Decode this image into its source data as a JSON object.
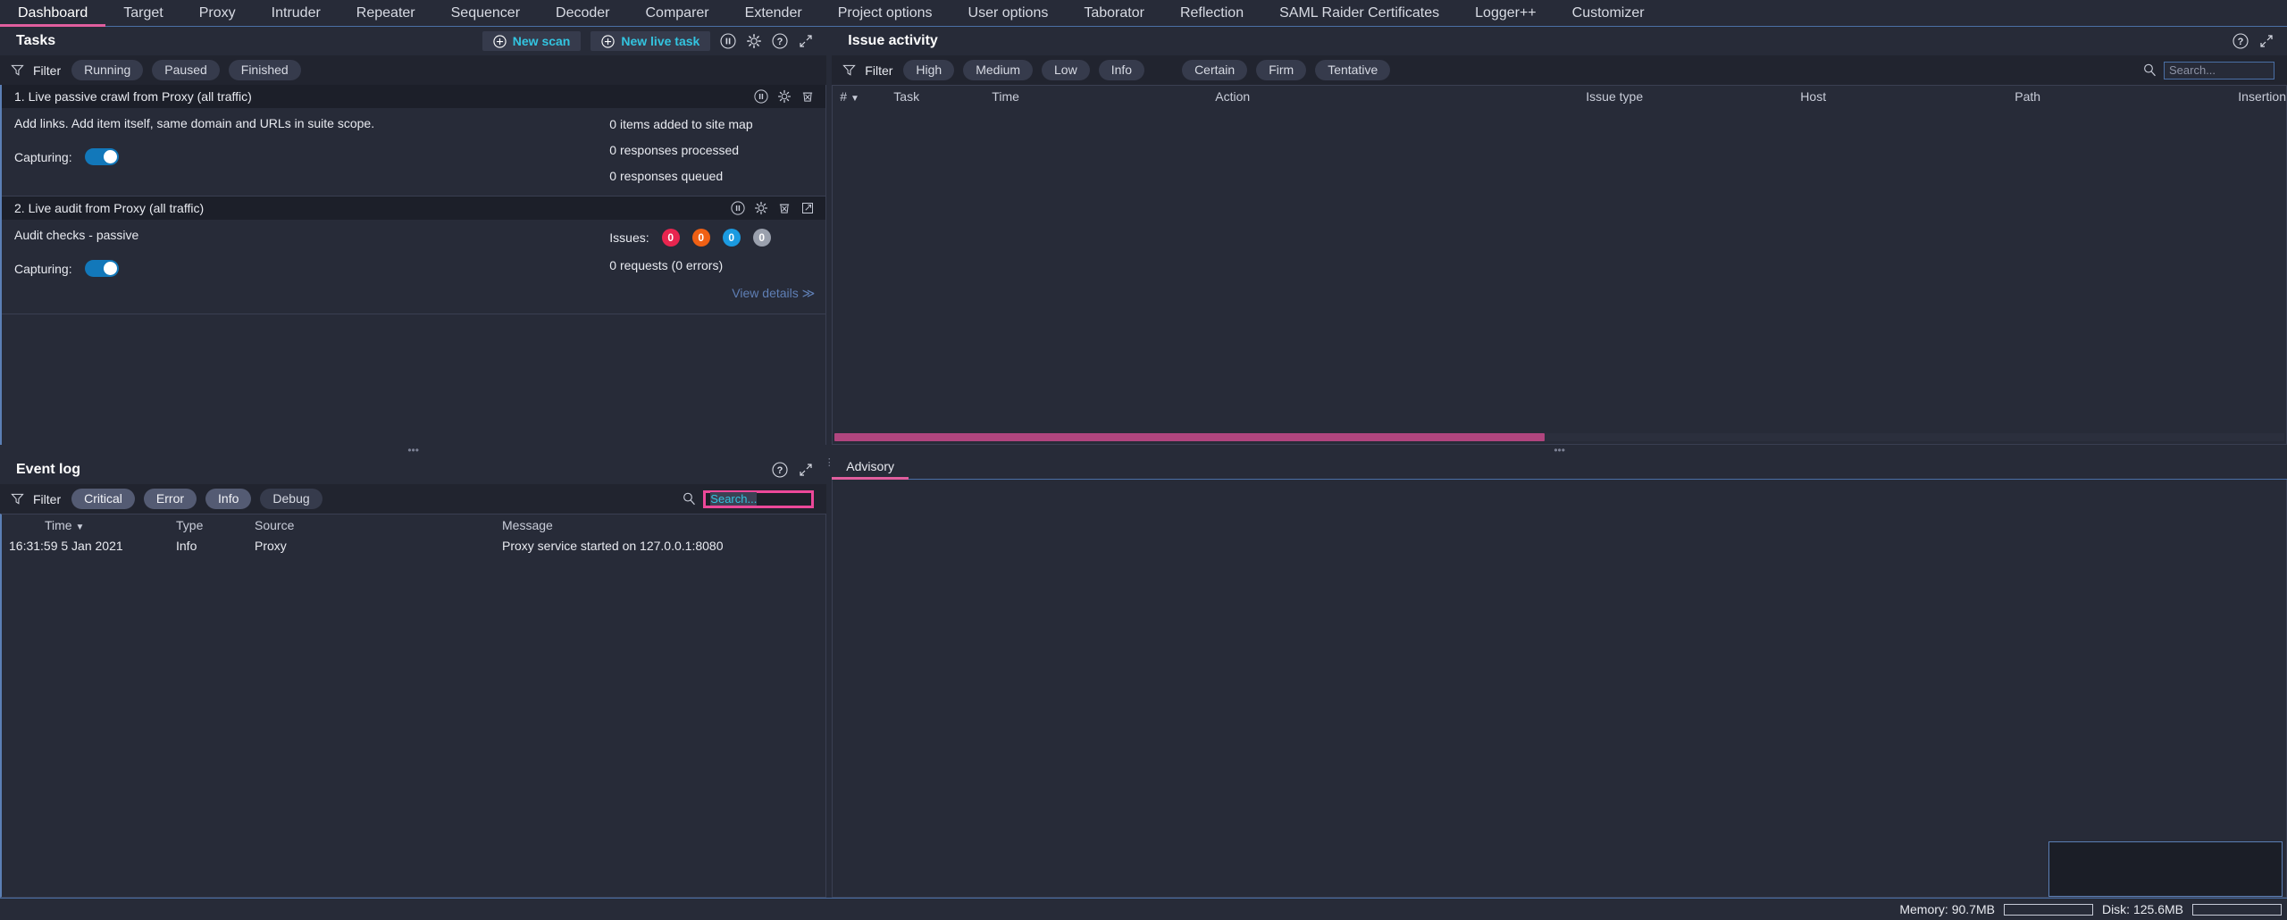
{
  "app": {
    "tabs": [
      {
        "label": "Dashboard",
        "active": true
      },
      {
        "label": "Target",
        "active": false
      },
      {
        "label": "Proxy",
        "active": false
      },
      {
        "label": "Intruder",
        "active": false
      },
      {
        "label": "Repeater",
        "active": false
      },
      {
        "label": "Sequencer",
        "active": false
      },
      {
        "label": "Decoder",
        "active": false
      },
      {
        "label": "Comparer",
        "active": false
      },
      {
        "label": "Extender",
        "active": false
      },
      {
        "label": "Project options",
        "active": false
      },
      {
        "label": "User options",
        "active": false
      },
      {
        "label": "Taborator",
        "active": false
      },
      {
        "label": "Reflection",
        "active": false
      },
      {
        "label": "SAML Raider Certificates",
        "active": false
      },
      {
        "label": "Logger++",
        "active": false
      },
      {
        "label": "Customizer",
        "active": false
      }
    ],
    "accent_pink": "#e05e9e",
    "accent_cyan": "#33c4e0",
    "accent_blue": "#1278ba"
  },
  "tasks": {
    "title": "Tasks",
    "new_scan_label": "New scan",
    "new_live_task_label": "New live task",
    "filter_label": "Filter",
    "filters": [
      {
        "label": "Running",
        "selected": false
      },
      {
        "label": "Paused",
        "selected": false
      },
      {
        "label": "Finished",
        "selected": false
      }
    ],
    "items": [
      {
        "title": "1. Live passive crawl from Proxy (all traffic)",
        "description": "Add links. Add item itself, same domain and URLs in suite scope.",
        "capturing_label": "Capturing:",
        "capturing_on": true,
        "stats": [
          "0 items added to site map",
          "0 responses processed",
          "0 responses queued"
        ],
        "has_issues": false,
        "has_open_icon": false
      },
      {
        "title": "2. Live audit from Proxy (all traffic)",
        "description": "Audit checks - passive",
        "capturing_label": "Capturing:",
        "capturing_on": true,
        "issues_label": "Issues:",
        "issue_counts": [
          {
            "value": "0",
            "color": "#e8254f"
          },
          {
            "value": "0",
            "color": "#f06014"
          },
          {
            "value": "0",
            "color": "#1b9ae0"
          },
          {
            "value": "0",
            "color": "#9aa0ad"
          }
        ],
        "requests_line": "0 requests (0 errors)",
        "view_details_label": "View details",
        "has_issues": true,
        "has_open_icon": true
      }
    ]
  },
  "event_log": {
    "title": "Event log",
    "filter_label": "Filter",
    "filters": [
      {
        "label": "Critical",
        "selected": true
      },
      {
        "label": "Error",
        "selected": true
      },
      {
        "label": "Info",
        "selected": true
      },
      {
        "label": "Debug",
        "selected": false
      }
    ],
    "search_placeholder": "Search...",
    "search_focused": true,
    "columns": [
      "Time",
      "Type",
      "Source",
      "Message"
    ],
    "sort_column": "Time",
    "rows": [
      {
        "time": "16:31:59 5 Jan 2021",
        "type": "Info",
        "source": "Proxy",
        "message": "Proxy service started on 127.0.0.1:8080"
      }
    ]
  },
  "issue_activity": {
    "title": "Issue activity",
    "filter_label": "Filter",
    "severity_filters": [
      {
        "label": "High",
        "selected": false
      },
      {
        "label": "Medium",
        "selected": false
      },
      {
        "label": "Low",
        "selected": false
      },
      {
        "label": "Info",
        "selected": false
      }
    ],
    "confidence_filters": [
      {
        "label": "Certain",
        "selected": false
      },
      {
        "label": "Firm",
        "selected": false
      },
      {
        "label": "Tentative",
        "selected": false
      }
    ],
    "search_placeholder": "Search...",
    "columns": [
      "#",
      "Task",
      "Time",
      "Action",
      "Issue type",
      "Host",
      "Path",
      "Insertion"
    ],
    "sort_column": "#",
    "rows": []
  },
  "advisory": {
    "tabs": [
      {
        "label": "Advisory",
        "active": true
      }
    ],
    "body_text": ""
  },
  "status_bar": {
    "memory_label": "Memory: 90.7MB",
    "disk_label": "Disk: 125.6MB"
  },
  "icons": {
    "pause": "pause-icon",
    "gear": "gear-icon",
    "help": "help-icon",
    "expand": "expand-icon",
    "trash": "trash-icon",
    "open_external": "open-external-icon",
    "plus": "plus-circle-icon",
    "funnel": "funnel-icon",
    "search": "search-icon"
  }
}
